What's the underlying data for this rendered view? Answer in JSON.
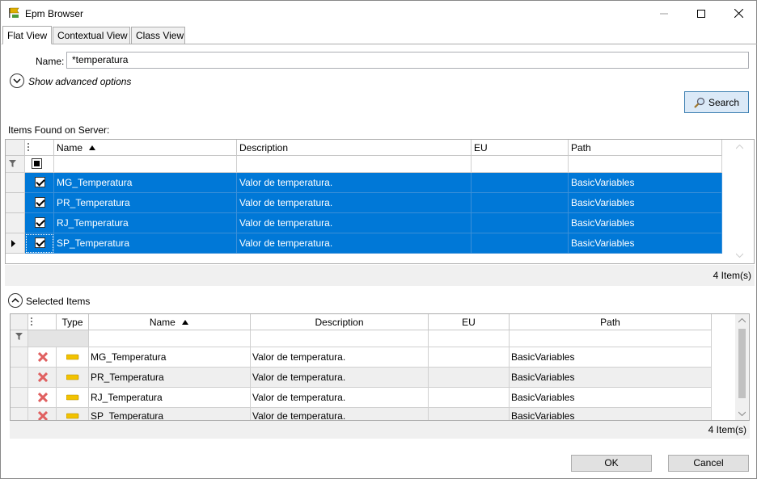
{
  "window": {
    "title": "Epm Browser"
  },
  "tabs": [
    {
      "label": "Flat View",
      "active": true
    },
    {
      "label": "Contextual View",
      "active": false
    },
    {
      "label": "Class View",
      "active": false
    }
  ],
  "search": {
    "name_label": "Name:",
    "name_value": "*temperatura",
    "advanced_label": "Show advanced options",
    "search_button": "Search"
  },
  "found": {
    "section_label": "Items Found on Server:",
    "columns": [
      "Name",
      "Description",
      "EU",
      "Path"
    ],
    "rows": [
      {
        "checked": true,
        "name": "MG_Temperatura",
        "description": "Valor de temperatura.",
        "eu": "",
        "path": "BasicVariables"
      },
      {
        "checked": true,
        "name": "PR_Temperatura",
        "description": "Valor de temperatura.",
        "eu": "",
        "path": "BasicVariables"
      },
      {
        "checked": true,
        "name": "RJ_Temperatura",
        "description": "Valor de temperatura.",
        "eu": "",
        "path": "BasicVariables"
      },
      {
        "checked": true,
        "name": "SP_Temperatura",
        "description": "Valor de temperatura.",
        "eu": "",
        "path": "BasicVariables"
      }
    ],
    "count": "4 Item(s)"
  },
  "selected": {
    "section_label": "Selected Items",
    "columns": [
      "Type",
      "Name",
      "Description",
      "EU",
      "Path"
    ],
    "rows": [
      {
        "name": "MG_Temperatura",
        "description": "Valor de temperatura.",
        "eu": "",
        "path": "BasicVariables"
      },
      {
        "name": "PR_Temperatura",
        "description": "Valor de temperatura.",
        "eu": "",
        "path": "BasicVariables"
      },
      {
        "name": "RJ_Temperatura",
        "description": "Valor de temperatura.",
        "eu": "",
        "path": "BasicVariables"
      },
      {
        "name": "SP_Temperatura",
        "description": "Valor de temperatura.",
        "eu": "",
        "path": "BasicVariables"
      }
    ],
    "count": "4 Item(s)"
  },
  "footer": {
    "ok": "OK",
    "cancel": "Cancel"
  },
  "colors": {
    "selection": "#0078d7",
    "search_button_bg": "#dbe9f7",
    "search_button_border": "#3c7fb1"
  }
}
